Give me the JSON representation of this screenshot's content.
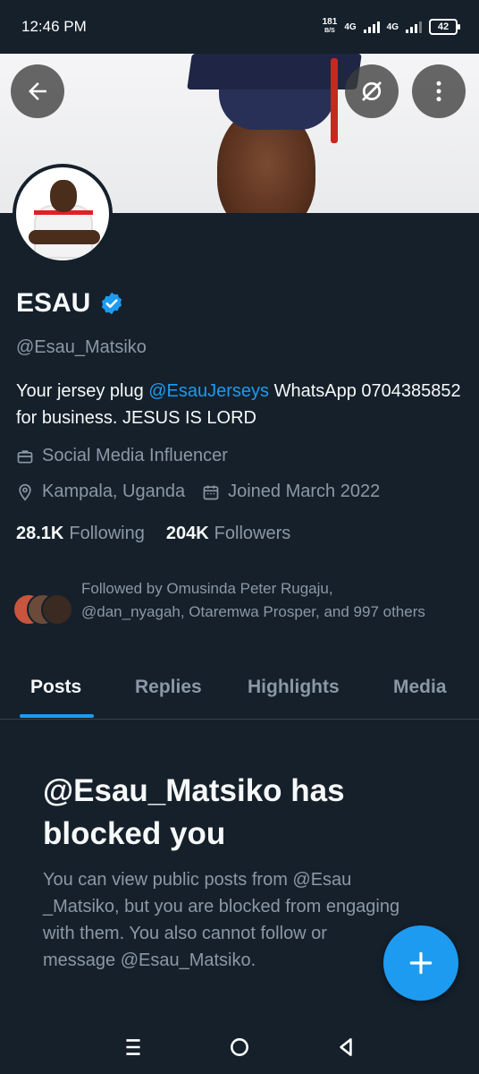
{
  "status_bar": {
    "time": "12:46 PM",
    "net_speed_value": "181",
    "net_speed_unit": "B/S",
    "network_1": "4G",
    "network_2": "4G",
    "battery": "42"
  },
  "header": {
    "back_icon": "arrow-left-icon",
    "grok_icon": "grok-icon",
    "more_icon": "more-vertical-icon"
  },
  "profile": {
    "name": "ESAU",
    "verified_icon": "verified-badge-icon",
    "handle": "@Esau_Matsiko",
    "bio_before": "Your jersey plug ",
    "bio_mention": "@EsauJerseys",
    "bio_after": " WhatsApp 0704385852 for business. JESUS IS LORD",
    "category": "Social Media Influencer",
    "location": "Kampala, Uganda",
    "joined": "Joined March 2022",
    "following_count": "28.1K",
    "following_label": "Following",
    "followers_count": "204K",
    "followers_label": "Followers",
    "followed_by": "Followed by Omusinda Peter Rugaju, @dan_nyagah, Otaremwa Prosper, and 997 others"
  },
  "tabs": [
    {
      "label": "Posts",
      "active": true
    },
    {
      "label": "Replies",
      "active": false
    },
    {
      "label": "Highlights",
      "active": false
    },
    {
      "label": "Media",
      "active": false
    }
  ],
  "blocked": {
    "title": "@Esau_Matsiko has blocked you",
    "message": "You can view public posts from @Esau _Matsiko, but you are blocked from engaging with them. You also cannot follow or message @Esau_Matsiko."
  },
  "fab": {
    "icon": "plus-icon"
  },
  "colors": {
    "background": "#15202b",
    "accent": "#1d9bf0",
    "secondary_text": "#8b98a5"
  }
}
